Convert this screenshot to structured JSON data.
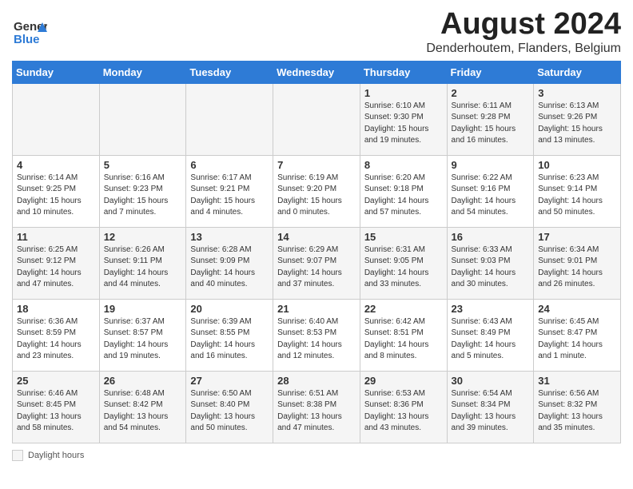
{
  "header": {
    "logo_line1": "General",
    "logo_line2": "Blue",
    "month_year": "August 2024",
    "location": "Denderhoutem, Flanders, Belgium"
  },
  "days_of_week": [
    "Sunday",
    "Monday",
    "Tuesday",
    "Wednesday",
    "Thursday",
    "Friday",
    "Saturday"
  ],
  "weeks": [
    [
      {
        "day": "",
        "info": ""
      },
      {
        "day": "",
        "info": ""
      },
      {
        "day": "",
        "info": ""
      },
      {
        "day": "",
        "info": ""
      },
      {
        "day": "1",
        "info": "Sunrise: 6:10 AM\nSunset: 9:30 PM\nDaylight: 15 hours\nand 19 minutes."
      },
      {
        "day": "2",
        "info": "Sunrise: 6:11 AM\nSunset: 9:28 PM\nDaylight: 15 hours\nand 16 minutes."
      },
      {
        "day": "3",
        "info": "Sunrise: 6:13 AM\nSunset: 9:26 PM\nDaylight: 15 hours\nand 13 minutes."
      }
    ],
    [
      {
        "day": "4",
        "info": "Sunrise: 6:14 AM\nSunset: 9:25 PM\nDaylight: 15 hours\nand 10 minutes."
      },
      {
        "day": "5",
        "info": "Sunrise: 6:16 AM\nSunset: 9:23 PM\nDaylight: 15 hours\nand 7 minutes."
      },
      {
        "day": "6",
        "info": "Sunrise: 6:17 AM\nSunset: 9:21 PM\nDaylight: 15 hours\nand 4 minutes."
      },
      {
        "day": "7",
        "info": "Sunrise: 6:19 AM\nSunset: 9:20 PM\nDaylight: 15 hours\nand 0 minutes."
      },
      {
        "day": "8",
        "info": "Sunrise: 6:20 AM\nSunset: 9:18 PM\nDaylight: 14 hours\nand 57 minutes."
      },
      {
        "day": "9",
        "info": "Sunrise: 6:22 AM\nSunset: 9:16 PM\nDaylight: 14 hours\nand 54 minutes."
      },
      {
        "day": "10",
        "info": "Sunrise: 6:23 AM\nSunset: 9:14 PM\nDaylight: 14 hours\nand 50 minutes."
      }
    ],
    [
      {
        "day": "11",
        "info": "Sunrise: 6:25 AM\nSunset: 9:12 PM\nDaylight: 14 hours\nand 47 minutes."
      },
      {
        "day": "12",
        "info": "Sunrise: 6:26 AM\nSunset: 9:11 PM\nDaylight: 14 hours\nand 44 minutes."
      },
      {
        "day": "13",
        "info": "Sunrise: 6:28 AM\nSunset: 9:09 PM\nDaylight: 14 hours\nand 40 minutes."
      },
      {
        "day": "14",
        "info": "Sunrise: 6:29 AM\nSunset: 9:07 PM\nDaylight: 14 hours\nand 37 minutes."
      },
      {
        "day": "15",
        "info": "Sunrise: 6:31 AM\nSunset: 9:05 PM\nDaylight: 14 hours\nand 33 minutes."
      },
      {
        "day": "16",
        "info": "Sunrise: 6:33 AM\nSunset: 9:03 PM\nDaylight: 14 hours\nand 30 minutes."
      },
      {
        "day": "17",
        "info": "Sunrise: 6:34 AM\nSunset: 9:01 PM\nDaylight: 14 hours\nand 26 minutes."
      }
    ],
    [
      {
        "day": "18",
        "info": "Sunrise: 6:36 AM\nSunset: 8:59 PM\nDaylight: 14 hours\nand 23 minutes."
      },
      {
        "day": "19",
        "info": "Sunrise: 6:37 AM\nSunset: 8:57 PM\nDaylight: 14 hours\nand 19 minutes."
      },
      {
        "day": "20",
        "info": "Sunrise: 6:39 AM\nSunset: 8:55 PM\nDaylight: 14 hours\nand 16 minutes."
      },
      {
        "day": "21",
        "info": "Sunrise: 6:40 AM\nSunset: 8:53 PM\nDaylight: 14 hours\nand 12 minutes."
      },
      {
        "day": "22",
        "info": "Sunrise: 6:42 AM\nSunset: 8:51 PM\nDaylight: 14 hours\nand 8 minutes."
      },
      {
        "day": "23",
        "info": "Sunrise: 6:43 AM\nSunset: 8:49 PM\nDaylight: 14 hours\nand 5 minutes."
      },
      {
        "day": "24",
        "info": "Sunrise: 6:45 AM\nSunset: 8:47 PM\nDaylight: 14 hours\nand 1 minute."
      }
    ],
    [
      {
        "day": "25",
        "info": "Sunrise: 6:46 AM\nSunset: 8:45 PM\nDaylight: 13 hours\nand 58 minutes."
      },
      {
        "day": "26",
        "info": "Sunrise: 6:48 AM\nSunset: 8:42 PM\nDaylight: 13 hours\nand 54 minutes."
      },
      {
        "day": "27",
        "info": "Sunrise: 6:50 AM\nSunset: 8:40 PM\nDaylight: 13 hours\nand 50 minutes."
      },
      {
        "day": "28",
        "info": "Sunrise: 6:51 AM\nSunset: 8:38 PM\nDaylight: 13 hours\nand 47 minutes."
      },
      {
        "day": "29",
        "info": "Sunrise: 6:53 AM\nSunset: 8:36 PM\nDaylight: 13 hours\nand 43 minutes."
      },
      {
        "day": "30",
        "info": "Sunrise: 6:54 AM\nSunset: 8:34 PM\nDaylight: 13 hours\nand 39 minutes."
      },
      {
        "day": "31",
        "info": "Sunrise: 6:56 AM\nSunset: 8:32 PM\nDaylight: 13 hours\nand 35 minutes."
      }
    ]
  ],
  "footer": {
    "daylight_label": "Daylight hours"
  }
}
